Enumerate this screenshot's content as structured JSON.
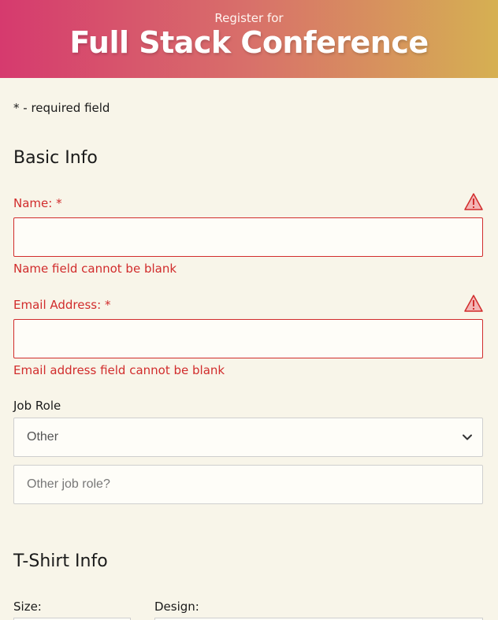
{
  "header": {
    "pretitle": "Register for",
    "title": "Full Stack Conference"
  },
  "required_note": "* - required field",
  "basic_info": {
    "heading": "Basic Info",
    "name": {
      "label": "Name: *",
      "value": "",
      "error": "Name field cannot be blank"
    },
    "email": {
      "label": "Email Address: *",
      "value": "",
      "error": "Email address field cannot be blank"
    },
    "job_role": {
      "label": "Job Role",
      "selected": "Other",
      "other_placeholder": "Other job role?"
    }
  },
  "tshirt_info": {
    "heading": "T-Shirt Info",
    "size_label": "Size:",
    "design_label": "Design:"
  },
  "colors": {
    "error": "#d12c2c",
    "background": "#f8f5e9",
    "gradient_start": "#d63a6e",
    "gradient_end": "#d6b052"
  },
  "icons": {
    "warning": "warning-icon",
    "dropdown": "chevron-down-icon"
  }
}
